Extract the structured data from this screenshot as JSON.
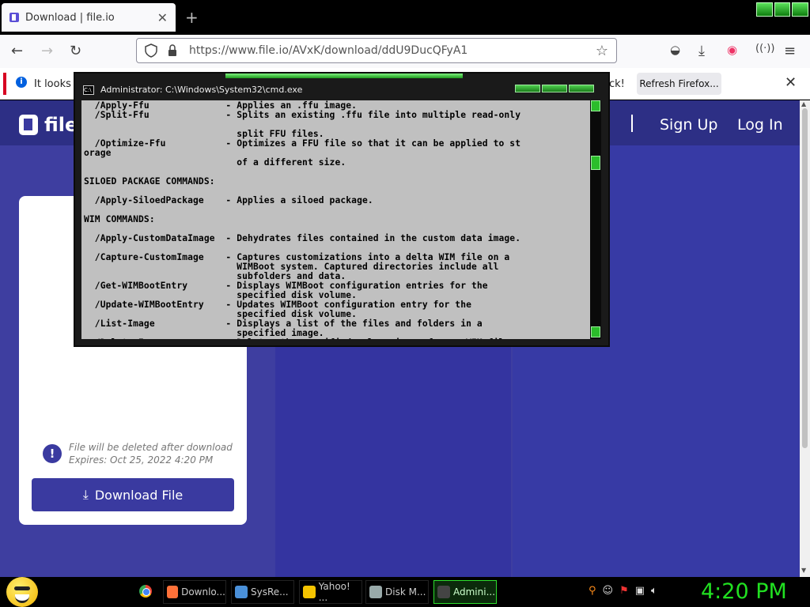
{
  "browser": {
    "tab_title": "Download | file.io",
    "tab_close": "✕",
    "new_tab": "+",
    "url": "https://www.file.io/AVxK/download/ddU9DucQFyA1",
    "notification": {
      "message": "It looks li",
      "message_tail": "ck!",
      "refresh_label": "Refresh Firefox...",
      "close": "✕"
    }
  },
  "site": {
    "logo_text": "file.",
    "sign_up": "Sign Up",
    "log_in": "Log In",
    "card": {
      "note_line1": "File will be deleted after download",
      "note_line2": "Expires: Oct 25, 2022 4:20 PM",
      "download_label": "Download File"
    }
  },
  "cmd": {
    "title": "Administrator: C:\\Windows\\System32\\cmd.exe",
    "lines": [
      "  /Apply-Ffu              - Applies an .ffu image.",
      "  /Split-Ffu              - Splits an existing .ffu file into multiple read-only",
      "",
      "                            split FFU files.",
      "  /Optimize-Ffu           - Optimizes a FFU file so that it can be applied to st",
      "orage",
      "                            of a different size.",
      "",
      "SILOED PACKAGE COMMANDS:",
      "",
      "  /Apply-SiloedPackage    - Applies a siloed package.",
      "",
      "WIM COMMANDS:",
      "",
      "  /Apply-CustomDataImage  - Dehydrates files contained in the custom data image.",
      "",
      "  /Capture-CustomImage    - Captures customizations into a delta WIM file on a",
      "                            WIMBoot system. Captured directories include all",
      "                            subfolders and data.",
      "  /Get-WIMBootEntry       - Displays WIMBoot configuration entries for the",
      "                            specified disk volume.",
      "  /Update-WIMBootEntry    - Updates WIMBoot configuration entry for the",
      "                            specified disk volume.",
      "  /List-Image             - Displays a list of the files and folders in a",
      "                            specified image.",
      "  /Delete-Image           - Deletes the specified volume image from a WIM file"
    ]
  },
  "taskbar": {
    "items": [
      {
        "label": "Downlo...",
        "color": "#ff7139"
      },
      {
        "label": "SysRe...",
        "color": "#4a90d9"
      },
      {
        "label": "Yahoo! ...",
        "color": "#f5c400"
      },
      {
        "label": "Disk M...",
        "color": "#9aa"
      },
      {
        "label": "Admini...",
        "color": "#444"
      }
    ],
    "clock": "4:20 PM"
  }
}
